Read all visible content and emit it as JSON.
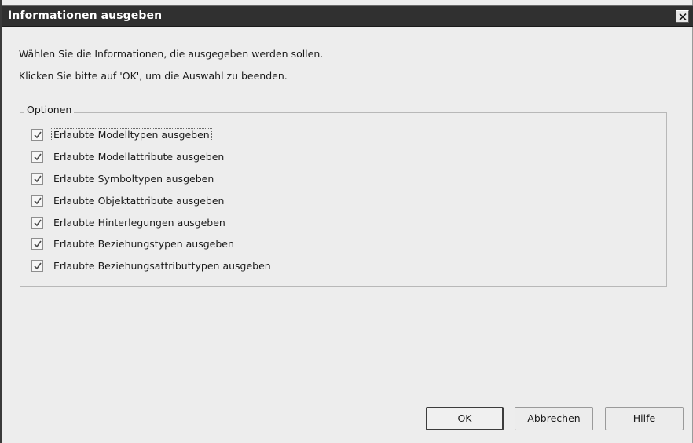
{
  "window": {
    "title": "Informationen ausgeben",
    "close_icon": "close-icon"
  },
  "messages": {
    "line1": "Wählen Sie die Informationen, die ausgegeben werden sollen.",
    "line2": "Klicken Sie bitte auf 'OK', um die Auswahl zu beenden."
  },
  "options_group": {
    "label": "Optionen",
    "items": [
      {
        "label": "Erlaubte Modelltypen ausgeben",
        "checked": true
      },
      {
        "label": "Erlaubte Modellattribute ausgeben",
        "checked": true
      },
      {
        "label": "Erlaubte Symboltypen ausgeben",
        "checked": true
      },
      {
        "label": "Erlaubte Objektattribute ausgeben",
        "checked": true
      },
      {
        "label": "Erlaubte Hinterlegungen ausgeben",
        "checked": true
      },
      {
        "label": "Erlaubte Beziehungstypen ausgeben",
        "checked": true
      },
      {
        "label": "Erlaubte Beziehungsattributtypen ausgeben",
        "checked": true
      }
    ]
  },
  "buttons": {
    "ok": "OK",
    "cancel": "Abbrechen",
    "help": "Hilfe"
  }
}
